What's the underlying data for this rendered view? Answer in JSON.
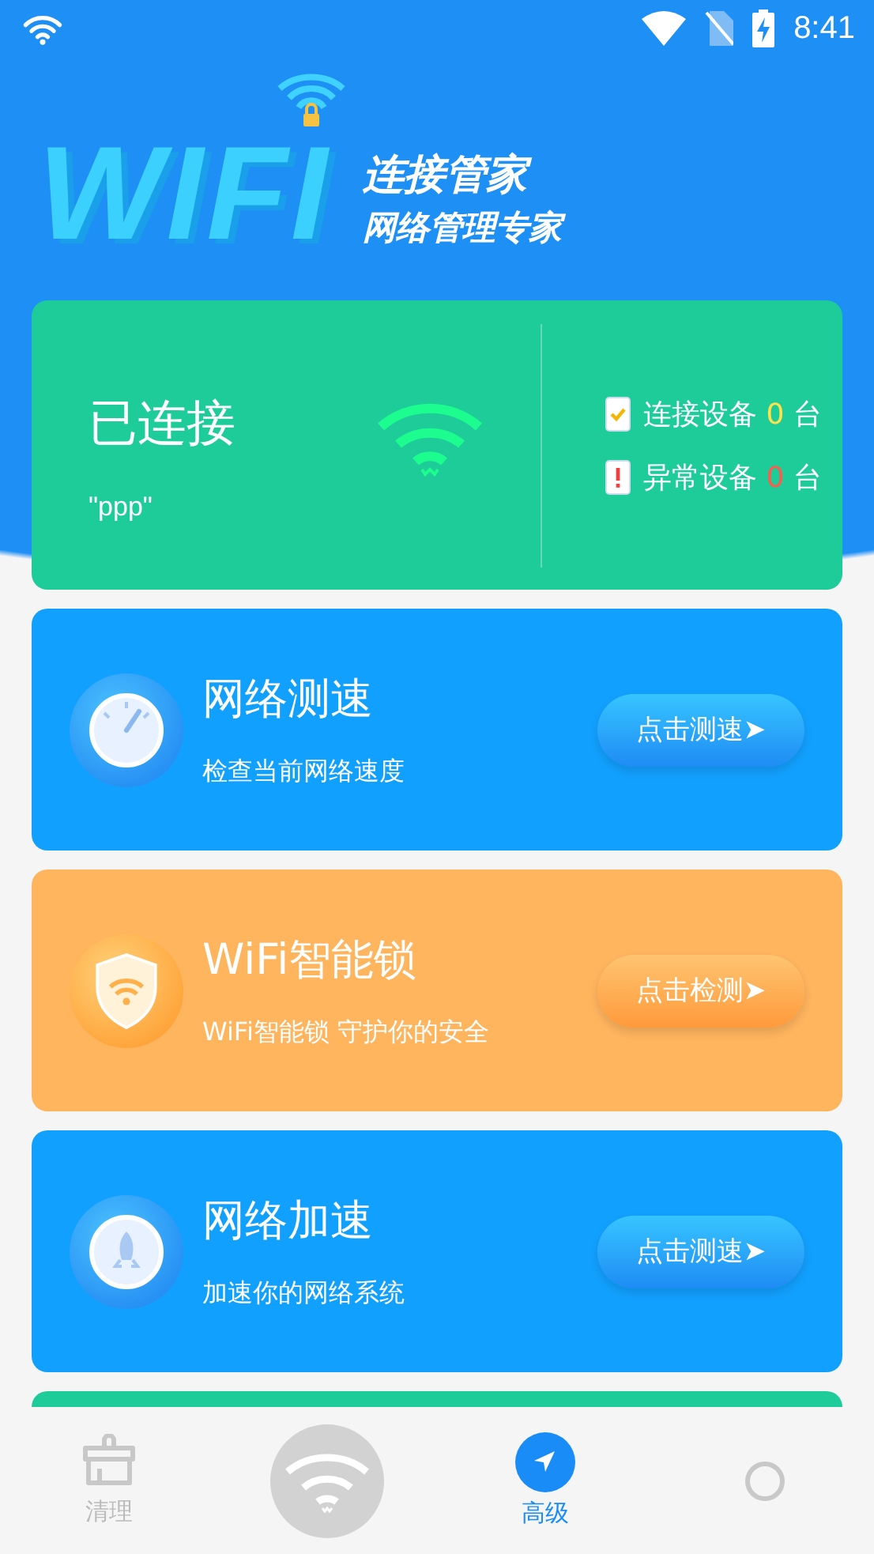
{
  "status_bar": {
    "time": "8:41"
  },
  "header": {
    "logo": "WIFI",
    "title": "连接管家",
    "subtitle": "网络管理专家"
  },
  "connection": {
    "status": "已连接",
    "network": "\"ppp\"",
    "stats": [
      {
        "kind": "ok",
        "label": "连接设备",
        "count": "0",
        "unit": "台"
      },
      {
        "kind": "alert",
        "label": "异常设备",
        "count": "0",
        "unit": "台"
      }
    ]
  },
  "features": [
    {
      "kind": "speed",
      "color": "#12a0fe",
      "title": "网络测速",
      "subtitle": "检查当前网络速度",
      "button": "点击测速➤"
    },
    {
      "kind": "lock",
      "color": "#ffb45e",
      "title": "WiFi智能锁",
      "subtitle": "WiFi智能锁 守护你的安全",
      "button": "点击检测➤"
    },
    {
      "kind": "boost",
      "color": "#12a0fe",
      "title": "网络加速",
      "subtitle": "加速你的网络系统",
      "button": "点击测速➤"
    }
  ],
  "nav": [
    {
      "kind": "clean",
      "label": "清理",
      "selected": false
    },
    {
      "kind": "wifi",
      "selected": false
    },
    {
      "kind": "advanced",
      "label": "高级",
      "selected": true
    },
    {
      "kind": "other",
      "selected": false
    }
  ]
}
